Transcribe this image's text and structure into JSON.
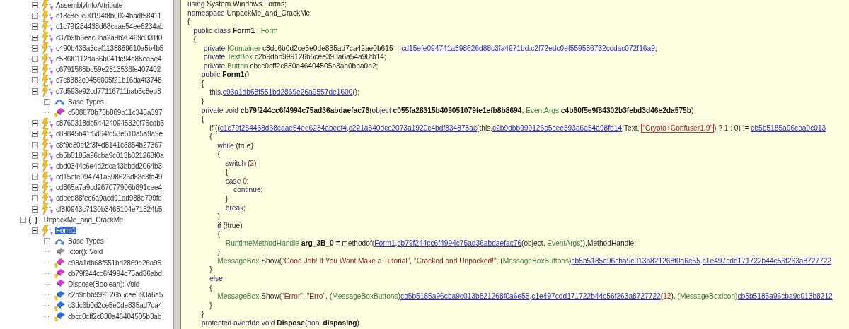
{
  "tree": [
    {
      "kind": "continued",
      "children": [
        {
          "kind": "class",
          "label": "AssemblyInfoAttribute",
          "expanded": false
        },
        {
          "kind": "class",
          "label": "c13c8e0c90194f8b0024badf58411",
          "expanded": false
        },
        {
          "kind": "class",
          "label": "c1c79f284438d68caae54ee6234ab",
          "expanded": false
        },
        {
          "kind": "class",
          "label": "c37b9fb6eac3ba2a9b20469d331f0",
          "expanded": false
        },
        {
          "kind": "class",
          "label": "c490b438a3cef1135889610a5b4b5",
          "expanded": false
        },
        {
          "kind": "class",
          "label": "c536f0112da36b041fc94a85ee5e4",
          "expanded": false
        },
        {
          "kind": "class",
          "label": "c6791565bd59e2313536fe407402",
          "expanded": false
        },
        {
          "kind": "class",
          "label": "c7c8382c0456095f21b16da4f3748",
          "expanded": false
        },
        {
          "kind": "class",
          "label": "c7d593e92cd77116711bab5c8eb3",
          "expanded": true,
          "children": [
            {
              "kind": "base_types",
              "label": "Base Types",
              "expanded": false
            },
            {
              "kind": "method",
              "label": "c508670b75b809b11c345a397",
              "private": true
            }
          ]
        },
        {
          "kind": "class",
          "label": "c8760318db544240945320f75cdb5",
          "expanded": false
        },
        {
          "kind": "class",
          "label": "c89845b41f5d64fd53e510a5a9a9e",
          "expanded": false
        },
        {
          "kind": "class",
          "label": "c8f9e30ef2f3f4d8141c8854b27367",
          "expanded": false
        },
        {
          "kind": "class",
          "label": "cb5b5185a96cba9c013b821268f0a",
          "expanded": false
        },
        {
          "kind": "class",
          "label": "cbd0344c6e4d2dca43bbdd2064b3",
          "expanded": false
        },
        {
          "kind": "class",
          "label": "cd15efe094741a598626d88c3fa49",
          "expanded": false
        },
        {
          "kind": "class",
          "label": "cd865a7a9cd267077906b891cee4",
          "expanded": false
        },
        {
          "kind": "class",
          "label": "cdeed88fec6a9acd91ad988e709fe",
          "expanded": false
        },
        {
          "kind": "class",
          "label": "cf8f0943c7130b3465104e71824b5",
          "expanded": false
        }
      ]
    },
    {
      "kind": "namespace",
      "icon_text": "{ }",
      "label": "UnpackMe_and_CrackMe",
      "expanded": true,
      "children": [
        {
          "kind": "class",
          "label": "Form1",
          "expanded": true,
          "selected": true,
          "children": [
            {
              "kind": "base_types",
              "label": "Base Types",
              "expanded": false
            },
            {
              "kind": "ctor",
              "label": ".ctor(): Void"
            },
            {
              "kind": "method",
              "label": "c93a1db68f551bd2869e26a95",
              "private": true
            },
            {
              "kind": "method",
              "label": "cb79f244cc6f4994c75ad36abd",
              "private": true
            },
            {
              "kind": "method",
              "label": "Dispose(Boolean): Void",
              "private": false
            },
            {
              "kind": "field",
              "label": "c2b9dbb999126b5cee393a6a5",
              "private": true
            },
            {
              "kind": "field",
              "label": "c3dc6b0d2ce5e0de835ad7ca4",
              "private": true
            },
            {
              "kind": "field",
              "label": "cbcc0cff2c830a46404505b3ab",
              "private": true
            }
          ]
        }
      ]
    }
  ],
  "code": [
    [
      {
        "kind": "kw",
        "s": "using"
      },
      {
        "kind": "id",
        "s": " System.Windows.Forms;"
      }
    ],
    [
      {
        "kind": "kw",
        "s": "namespace"
      },
      {
        "kind": "id",
        "s": " UnpackMe_and_CrackMe"
      }
    ],
    [
      {
        "kind": "id",
        "s": "{"
      }
    ],
    [
      {
        "kind": "kw",
        "s": "   public class "
      },
      {
        "kind": "bold",
        "s": "Form1"
      },
      {
        "kind": "id",
        "s": " : "
      },
      {
        "kind": "type",
        "s": "Form"
      }
    ],
    [
      {
        "kind": "id",
        "s": "   {"
      }
    ],
    [
      {
        "kind": "kw",
        "s": "        private"
      },
      {
        "kind": "type",
        "s": " IContainer"
      },
      {
        "kind": "id",
        "s": " c3dc6b0d2ce5e0de835ad7ca42ae0b615 = "
      },
      {
        "kind": "link",
        "s": "cd15efe094741a598626d88c3fa4971bd"
      },
      {
        "kind": "id",
        "s": "."
      },
      {
        "kind": "link",
        "s": "c2f72edc0ef559556732ccdac072f16a9"
      },
      {
        "kind": "id",
        "s": ";"
      }
    ],
    [
      {
        "kind": "kw",
        "s": "        private"
      },
      {
        "kind": "type",
        "s": " TextBox"
      },
      {
        "kind": "id",
        "s": " c2b9dbb999126b5cee393a6a54a98fb14;"
      }
    ],
    [
      {
        "kind": "kw",
        "s": "        private"
      },
      {
        "kind": "type",
        "s": " Button"
      },
      {
        "kind": "id",
        "s": " cbcc0cff2c830a46404505b3ab0bba0b2;"
      }
    ],
    [
      {
        "kind": "kw",
        "s": "       public "
      },
      {
        "kind": "bold",
        "s": "Form1"
      },
      {
        "kind": "id",
        "s": "()"
      }
    ],
    [
      {
        "kind": "id",
        "s": "       {"
      }
    ],
    [
      {
        "kind": "kw",
        "s": "           this"
      },
      {
        "kind": "id",
        "s": "."
      },
      {
        "kind": "link",
        "s": "c93a1db68f551bd2869e26a9557de1600"
      },
      {
        "kind": "id",
        "s": "();"
      }
    ],
    [
      {
        "kind": "id",
        "s": "       }"
      }
    ],
    [
      {
        "kind": "kw",
        "s": "       private void "
      },
      {
        "kind": "bold",
        "s": "cb79f244cc6f4994c75ad36abdaefac76"
      },
      {
        "kind": "id",
        "s": "("
      },
      {
        "kind": "kw",
        "s": "object "
      },
      {
        "kind": "bold",
        "s": "c055fa28315b409051079fe1efb8b8694"
      },
      {
        "kind": "id",
        "s": ", "
      },
      {
        "kind": "type",
        "s": "EventArgs "
      },
      {
        "kind": "bold",
        "s": "c4b60f5e9f84302b3febd3d46e2da575b"
      },
      {
        "kind": "id",
        "s": ")"
      }
    ],
    [
      {
        "kind": "id",
        "s": "       {"
      }
    ],
    [
      {
        "kind": "kw",
        "s": "           if"
      },
      {
        "kind": "id",
        "s": " (("
      },
      {
        "kind": "link",
        "s": "c1c79f284438d68caae54ee6234abecf4"
      },
      {
        "kind": "id",
        "s": "."
      },
      {
        "kind": "link",
        "s": "c221a840dcc2073a1920c4bdf834875ac"
      },
      {
        "kind": "id",
        "s": "(this."
      },
      {
        "kind": "link",
        "s": "c2b9dbb999126b5cee393a6a54a98fb14"
      },
      {
        "kind": "id",
        "s": ".Text, "
      },
      {
        "kind": "boxed",
        "s": "\"Crypto+Confuser1.9\""
      },
      {
        "kind": "id",
        "s": ") ? 1 : 0) != "
      },
      {
        "kind": "link",
        "s": "cb5b5185a96cba9c013"
      }
    ],
    [
      {
        "kind": "id",
        "s": "           {"
      }
    ],
    [
      {
        "kind": "kw",
        "s": "               while"
      },
      {
        "kind": "id",
        "s": " (true)"
      }
    ],
    [
      {
        "kind": "id",
        "s": "               {"
      }
    ],
    [
      {
        "kind": "kw",
        "s": "                   switch"
      },
      {
        "kind": "id",
        "s": " ("
      },
      {
        "kind": "num",
        "s": "2"
      },
      {
        "kind": "id",
        "s": ")"
      }
    ],
    [
      {
        "kind": "id",
        "s": "                   {"
      }
    ],
    [
      {
        "kind": "kw",
        "s": "                   case "
      },
      {
        "kind": "num",
        "s": "0"
      },
      {
        "kind": "id",
        "s": ":"
      }
    ],
    [
      {
        "kind": "kw",
        "s": "                       continue;"
      }
    ],
    [
      {
        "kind": "id",
        "s": "                   }"
      }
    ],
    [
      {
        "kind": "kw",
        "s": "                   break;"
      }
    ],
    [
      {
        "kind": "id",
        "s": "               }"
      }
    ],
    [
      {
        "kind": "kw",
        "s": "               if"
      },
      {
        "kind": "id",
        "s": " (!true)"
      }
    ],
    [
      {
        "kind": "id",
        "s": "               {"
      }
    ],
    [
      {
        "kind": "type",
        "s": "                   RuntimeMethodHandle "
      },
      {
        "kind": "bold",
        "s": "arg_3B_0 ="
      },
      {
        "kind": "id",
        "s": " methodof("
      },
      {
        "kind": "link",
        "s": "Form1"
      },
      {
        "kind": "id",
        "s": "."
      },
      {
        "kind": "link",
        "s": "cb79f244cc6f4994c75ad36abdaefac76"
      },
      {
        "kind": "id",
        "s": "(object, "
      },
      {
        "kind": "type",
        "s": "EventArgs"
      },
      {
        "kind": "id",
        "s": ")).MethodHandle;"
      }
    ],
    [
      {
        "kind": "id",
        "s": "               }"
      }
    ],
    [
      {
        "kind": "type",
        "s": "               MessageBox"
      },
      {
        "kind": "id",
        "s": ".Show("
      },
      {
        "kind": "str",
        "s": "\"Good Job! If You Want Make a Tutorial\""
      },
      {
        "kind": "id",
        "s": ", "
      },
      {
        "kind": "str",
        "s": "\"Cracked and Unpacked!\""
      },
      {
        "kind": "id",
        "s": ", ("
      },
      {
        "kind": "type",
        "s": "MessageBoxButtons"
      },
      {
        "kind": "id",
        "s": ")"
      },
      {
        "kind": "link",
        "s": "cb5b5185a96cba9c013b821268f0a6e55"
      },
      {
        "kind": "id",
        "s": "."
      },
      {
        "kind": "link",
        "s": "c1e497cdd171722b44c56f263a8727722"
      }
    ],
    [
      {
        "kind": "id",
        "s": "           }"
      }
    ],
    [
      {
        "kind": "kw",
        "s": "           else"
      }
    ],
    [
      {
        "kind": "id",
        "s": "           {"
      }
    ],
    [
      {
        "kind": "type",
        "s": "               MessageBox"
      },
      {
        "kind": "id",
        "s": ".Show("
      },
      {
        "kind": "str",
        "s": "\"Error\""
      },
      {
        "kind": "id",
        "s": ", "
      },
      {
        "kind": "str",
        "s": "\"Erro\""
      },
      {
        "kind": "id",
        "s": ", ("
      },
      {
        "kind": "type",
        "s": "MessageBoxButtons"
      },
      {
        "kind": "id",
        "s": ")"
      },
      {
        "kind": "link",
        "s": "cb5b5185a96cba9c013b821268f0a6e55"
      },
      {
        "kind": "id",
        "s": "."
      },
      {
        "kind": "link",
        "s": "c1e497cdd171722b44c56f263a8727722"
      },
      {
        "kind": "id",
        "s": "("
      },
      {
        "kind": "num",
        "s": "12"
      },
      {
        "kind": "id",
        "s": "), ("
      },
      {
        "kind": "type",
        "s": "MessageBoxIcon"
      },
      {
        "kind": "id",
        "s": ")"
      },
      {
        "kind": "link",
        "s": "cb5b5185a96cba9c013b8212"
      }
    ],
    [
      {
        "kind": "id",
        "s": "           }"
      }
    ],
    [
      {
        "kind": "id",
        "s": "       }"
      }
    ],
    [
      {
        "kind": "kw",
        "s": "       protected override void "
      },
      {
        "kind": "bold",
        "s": "Dispose"
      },
      {
        "kind": "id",
        "s": "("
      },
      {
        "kind": "kw",
        "s": "bool "
      },
      {
        "kind": "bold",
        "s": "disposing"
      },
      {
        "kind": "id",
        "s": ")"
      }
    ]
  ]
}
